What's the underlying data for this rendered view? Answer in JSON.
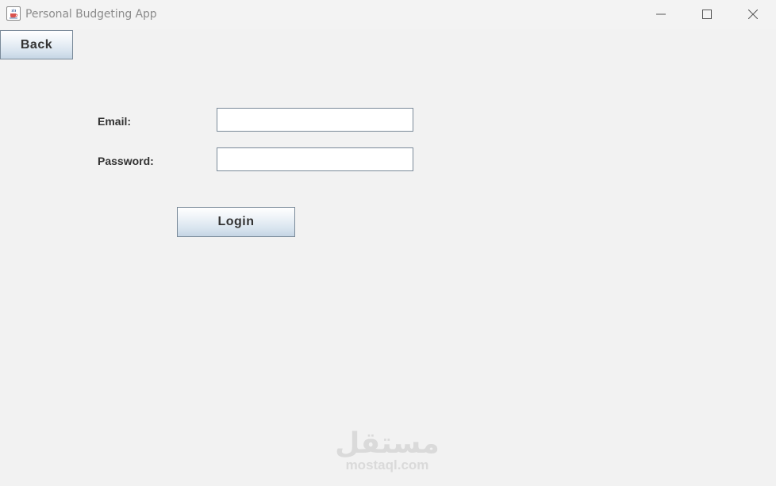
{
  "window": {
    "title": "Personal Budgeting App",
    "app_icon": "java-cup-icon",
    "controls": {
      "minimize_icon": "minimize-icon",
      "maximize_icon": "maximize-icon",
      "close_icon": "close-icon"
    }
  },
  "toolbar": {
    "back_label": "Back"
  },
  "form": {
    "email_label": "Email:",
    "email_value": "",
    "password_label": "Password:",
    "password_value": "",
    "login_label": "Login"
  },
  "watermark": {
    "arabic": "مستقل",
    "latin": "mostaql.com"
  },
  "colors": {
    "background": "#f2f2f2",
    "button_border": "#7a8a99",
    "button_gradient_top": "#ffffff",
    "button_gradient_bottom": "#c5d5e4",
    "text": "#333333",
    "title_text": "#8c8c8c"
  }
}
